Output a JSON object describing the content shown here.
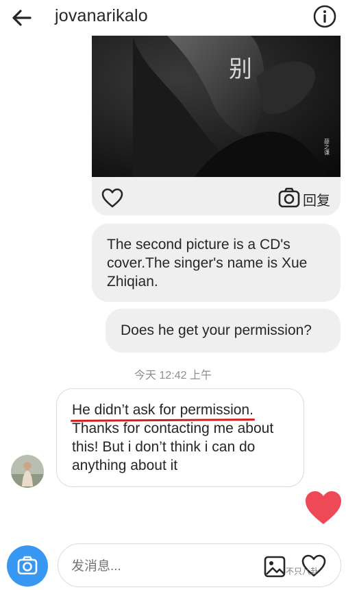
{
  "header": {
    "username": "jovanarikalo",
    "back_icon": "arrow-left-icon",
    "info_icon": "info-circle-icon"
  },
  "shared_post": {
    "cover_text": "别",
    "cover_side_text": "薛之谦",
    "reply_label": "回复",
    "like_icon": "heart-outline-icon",
    "camera_icon": "camera-icon"
  },
  "messages": {
    "sent_1": "The second picture is a CD's cover.The singer's name is Xue Zhiqian.",
    "sent_2": "Does he get your permission?",
    "timestamp": "今天 12:42 上午",
    "received_line1": "He didn’t ask for permission.",
    "received_rest": "Thanks for contacting me about this! But i don’t think i can do anything about it"
  },
  "composer": {
    "placeholder": "发消息...",
    "camera_icon": "camera-icon",
    "gallery_icon": "image-icon",
    "heart_icon": "heart-outline-icon"
  },
  "watermark": "不只八卦",
  "colors": {
    "accent": "#3897f0",
    "heart": "#ed4956",
    "bubble": "#efefef",
    "underline": "#d41e1e"
  }
}
